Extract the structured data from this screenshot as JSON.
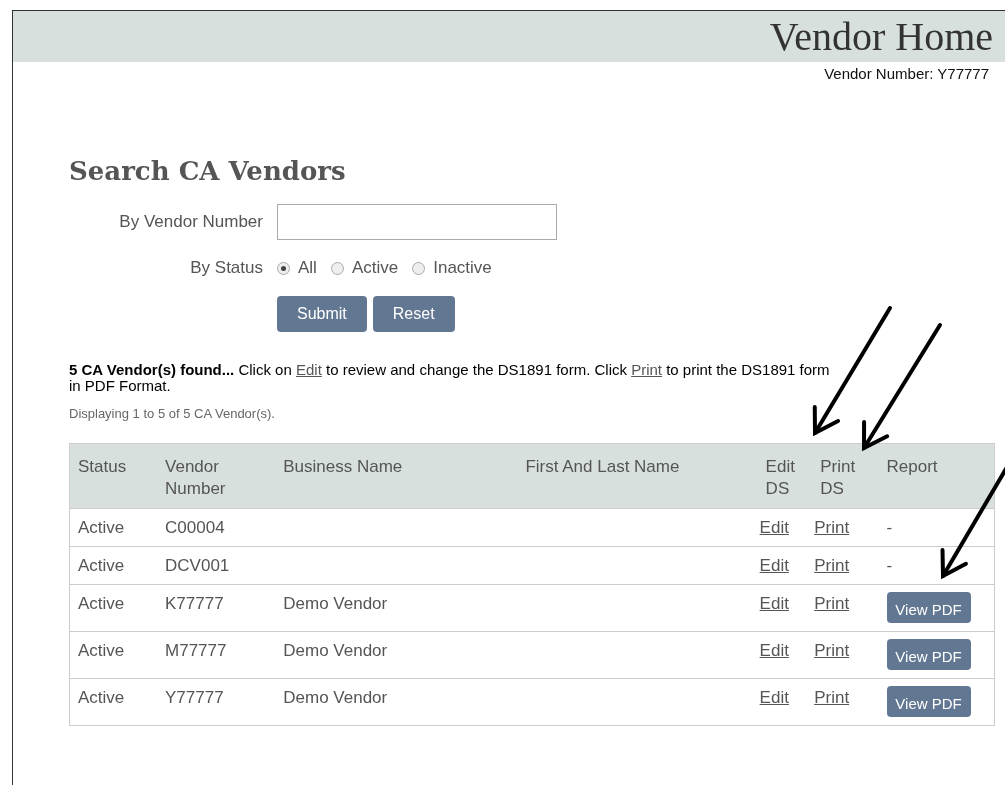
{
  "header": {
    "title": "Vendor Home",
    "vendor_number": "Vendor Number: Y77777"
  },
  "search": {
    "title": "Search CA Vendors",
    "vendor_number_label": "By Vendor Number",
    "status_label": "By Status",
    "status_options": [
      {
        "label": "All",
        "selected": true
      },
      {
        "label": "Active",
        "selected": false
      },
      {
        "label": "Inactive",
        "selected": false
      }
    ],
    "buttons": [
      "Submit",
      "Reset"
    ]
  },
  "message": [
    {
      "kind": "bold",
      "text": "5 CA Vendor(s) found..."
    },
    {
      "kind": "text",
      "text": " Click on "
    },
    {
      "kind": "link",
      "text": "Edit"
    },
    {
      "kind": "text",
      "text": " to review and change the DS1891 form. Click "
    },
    {
      "kind": "link",
      "text": "Print"
    },
    {
      "kind": "text",
      "text": " to print the DS1891 form in PDF Format."
    }
  ],
  "displaying": "Displaying 1 to 5 of 5 CA Vendor(s).",
  "table": {
    "columns": [
      "Status",
      "Vendor Number",
      "Business Name",
      "First And Last Name",
      "Edit DS",
      "Print DS",
      "Report"
    ],
    "rows": [
      {
        "status": "Active",
        "vendor_number": "C00004",
        "edit": "Edit",
        "print": "Print",
        "report": {
          "kind": "dash",
          "text": "-"
        }
      },
      {
        "status": "Active",
        "vendor_number": "DCV001",
        "edit": "Edit",
        "print": "Print",
        "report": {
          "kind": "dash",
          "text": "-"
        }
      },
      {
        "status": "Active",
        "vendor_number": "K77777",
        "business_name": "Demo Vendor",
        "edit": "Edit",
        "print": "Print",
        "report": {
          "kind": "button",
          "text": "View PDF"
        }
      },
      {
        "status": "Active",
        "vendor_number": "M77777",
        "business_name": "Demo Vendor",
        "edit": "Edit",
        "print": "Print",
        "report": {
          "kind": "button",
          "text": "View PDF"
        }
      },
      {
        "status": "Active",
        "vendor_number": "Y77777",
        "business_name": "Demo Vendor",
        "edit": "Edit",
        "print": "Print",
        "report": {
          "kind": "button",
          "text": "View PDF"
        }
      }
    ]
  },
  "annotations": [
    {
      "kind": "arrow"
    },
    {
      "kind": "arrow"
    },
    {
      "kind": "arrow"
    }
  ]
}
